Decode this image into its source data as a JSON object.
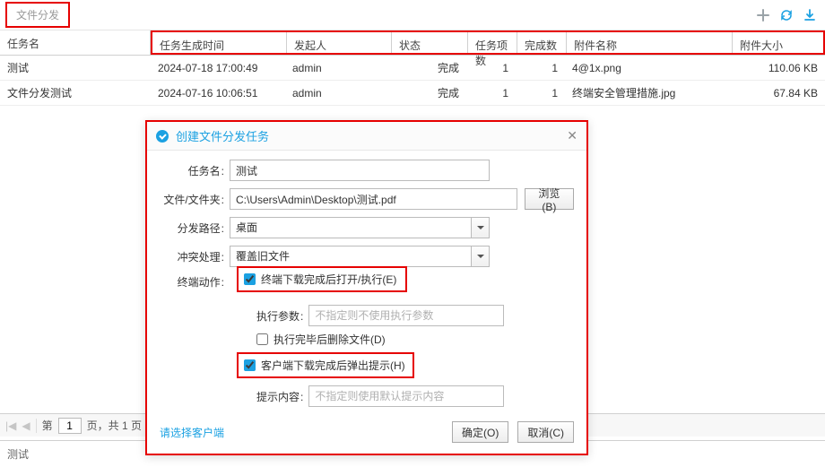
{
  "topbar": {
    "tab_label": "文件分发"
  },
  "icons": {
    "plus": "plus-icon",
    "refresh": "refresh-icon",
    "download": "download-icon"
  },
  "colors": {
    "accent": "#1BA1E2",
    "highlight": "#e60000"
  },
  "table": {
    "headers": {
      "name": "任务名",
      "time": "任务生成时间",
      "user": "发起人",
      "status": "状态",
      "items": "任务项数",
      "done": "完成数",
      "file": "附件名称",
      "size": "附件大小"
    },
    "rows": [
      {
        "name": "测试",
        "time": "2024-07-18 17:00:49",
        "user": "admin",
        "status": "完成",
        "items": "1",
        "done": "1",
        "file": "4@1x.png",
        "size": "110.06 KB"
      },
      {
        "name": "文件分发测试",
        "time": "2024-07-16 10:06:51",
        "user": "admin",
        "status": "完成",
        "items": "1",
        "done": "1",
        "file": "终端安全管理措施.jpg",
        "size": "67.84 KB"
      }
    ]
  },
  "pager": {
    "prefix": "第",
    "page": "1",
    "middle": "页，共 1 页",
    "bottom_label": "测试"
  },
  "dialog": {
    "title": "创建文件分发任务",
    "close": "✕",
    "labels": {
      "task_name": "任务名",
      "file": "文件/文件夹",
      "browse": "浏览(B)",
      "dist_path": "分发路径",
      "conflict": "冲突处理",
      "term_action": "终端动作",
      "exec_args": "执行参数",
      "delete_after": "执行完毕后删除文件(D)",
      "popup": "客户端下载完成后弹出提示(H)",
      "popup_content": "提示内容",
      "select_clients": "请选择客户端",
      "ok": "确定(O)",
      "cancel": "取消(C)"
    },
    "values": {
      "task_name": "测试",
      "file_path": "C:\\Users\\Admin\\Desktop\\测试.pdf",
      "dist_path": "桌面",
      "conflict": "覆盖旧文件",
      "open_after": "终端下载完成后打开/执行(E)"
    },
    "placeholders": {
      "exec_args": "不指定则不使用执行参数",
      "popup_content": "不指定则使用默认提示内容"
    },
    "checked": {
      "open_after": true,
      "delete_after": false,
      "popup": true
    }
  }
}
